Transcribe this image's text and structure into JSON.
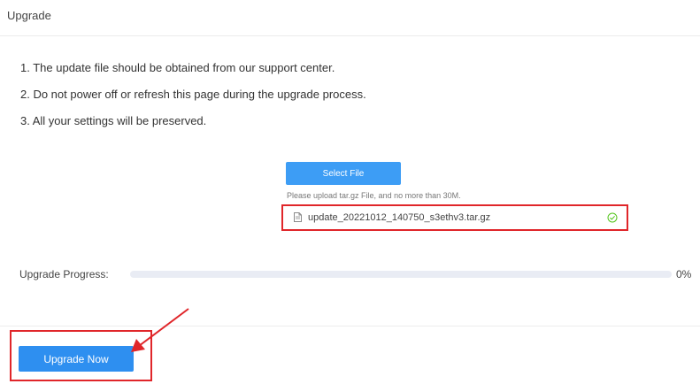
{
  "header": {
    "title": "Upgrade"
  },
  "notes": [
    "1. The update file should be obtained from our support center.",
    "2. Do not power off or refresh this page during the upgrade process.",
    "3. All your settings will be preserved."
  ],
  "upload": {
    "select_label": "Select File",
    "hint": "Please upload tar.gz File, and no more than 30M.",
    "file_name": "update_20221012_140750_s3ethv3.tar.gz",
    "file_icon": "file-icon",
    "status_icon": "check-circle-icon"
  },
  "progress": {
    "label": "Upgrade Progress:",
    "value": 0,
    "percent_text": "0%"
  },
  "actions": {
    "upgrade_label": "Upgrade Now"
  },
  "colors": {
    "accent": "#3d9df5",
    "button": "#2e8ff0",
    "highlight": "#e0262a",
    "success": "#52c41a"
  }
}
